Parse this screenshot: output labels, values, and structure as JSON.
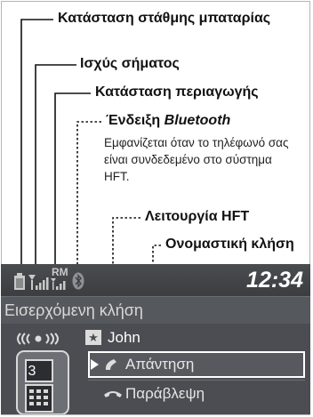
{
  "callouts": {
    "battery": "Κατάσταση στάθμης μπαταρίας",
    "signal": "Ισχύς σήματος",
    "roaming": "Κατάσταση περιαγωγής",
    "bluetooth_prefix": "Ένδειξη",
    "bluetooth_brand": "Bluetooth",
    "bluetooth_desc": "Εμφανίζεται όταν το τηλέφωνό σας είναι συνδεδεμένο στο σύστημα HFT.",
    "hft_function": "Λειτουργία HFT",
    "name_call": "Ονομαστική κλήση"
  },
  "screen": {
    "status": {
      "roaming": "RM",
      "clock": "12:34"
    },
    "title": "Εισερχόμενη κλήση",
    "caller": "John",
    "actions": {
      "answer": "Απάντηση",
      "ignore": "Παράβλεψη"
    },
    "keypad_digit": "3"
  },
  "colors": {
    "screen_bg": "#4b4d52",
    "statusbar": "#3f4145",
    "text": "#ffffff"
  }
}
